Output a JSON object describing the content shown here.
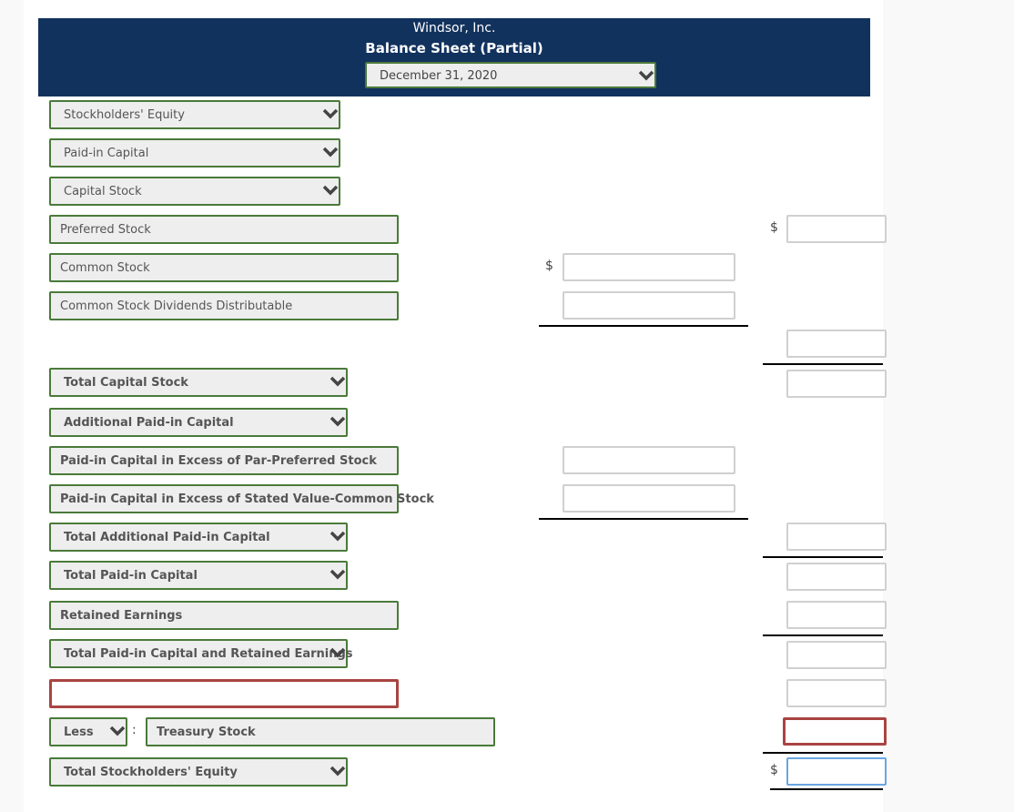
{
  "header": {
    "company": "Windsor, Inc.",
    "title": "Balance Sheet (Partial)",
    "date_select": "December 31, 2020"
  },
  "rows": {
    "stockholders_equity": "Stockholders' Equity",
    "paid_in_capital": "Paid-in Capital",
    "capital_stock": "Capital Stock",
    "preferred_stock": "Preferred Stock",
    "common_stock": "Common Stock",
    "common_stock_dividends": "Common Stock Dividends Distributable",
    "total_capital_stock": "Total Capital Stock",
    "additional_paid_in_capital": "Additional Paid-in Capital",
    "excess_par_preferred": "Paid-in Capital in Excess of Par-Preferred Stock",
    "excess_stated_common": "Paid-in Capital in Excess of Stated Value-Common Stock",
    "total_additional_paid_in": "Total Additional Paid-in Capital",
    "total_paid_in_capital": "Total Paid-in Capital",
    "retained_earnings": "Retained Earnings",
    "total_paid_in_and_retained": "Total Paid-in Capital and Retained Earnings",
    "blank_entry": "",
    "less_select": "Less",
    "colon": ":",
    "treasury_stock": "Treasury Stock",
    "total_stockholders_equity": "Total Stockholders' Equity"
  },
  "currency_symbol": "$",
  "inputs": {
    "preferred_stock_total": "",
    "common_stock_amount": "",
    "common_dividends_amount": "",
    "capital_stock_subtotal": "",
    "total_capital_stock": "",
    "excess_preferred_amount": "",
    "excess_common_amount": "",
    "total_additional_paid_in": "",
    "total_paid_in_capital": "",
    "retained_earnings": "",
    "total_paid_in_and_retained": "",
    "blank_row_amount": "",
    "treasury_stock_amount": "",
    "total_stockholders_equity": ""
  },
  "colors": {
    "header_bg": "#12325e",
    "field_border": "#4a7a3a",
    "error_border": "#a94442",
    "focus_border": "#6aa6e0"
  }
}
